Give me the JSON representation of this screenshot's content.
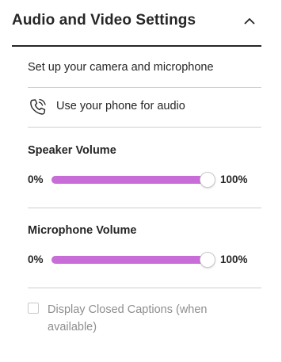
{
  "panel": {
    "title": "Audio and Video Settings",
    "collapse_icon": "chevron-up-icon",
    "setup_text": "Set up your camera and microphone",
    "phone_audio": {
      "label": "Use your phone for audio",
      "icon": "phone-icon"
    },
    "speaker_volume": {
      "label": "Speaker Volume",
      "min_label": "0%",
      "max_label": "100%",
      "value": 1.0
    },
    "microphone_volume": {
      "label": "Microphone Volume",
      "min_label": "0%",
      "max_label": "100%",
      "value": 1.0
    },
    "closed_captions": {
      "label": "Display Closed Captions (when available)",
      "checked": false,
      "disabled": true
    }
  },
  "colors": {
    "accent": "#c86dd7",
    "text": "#262626",
    "divider": "#cfcfcf",
    "disabled_text": "#8e8e8e"
  }
}
